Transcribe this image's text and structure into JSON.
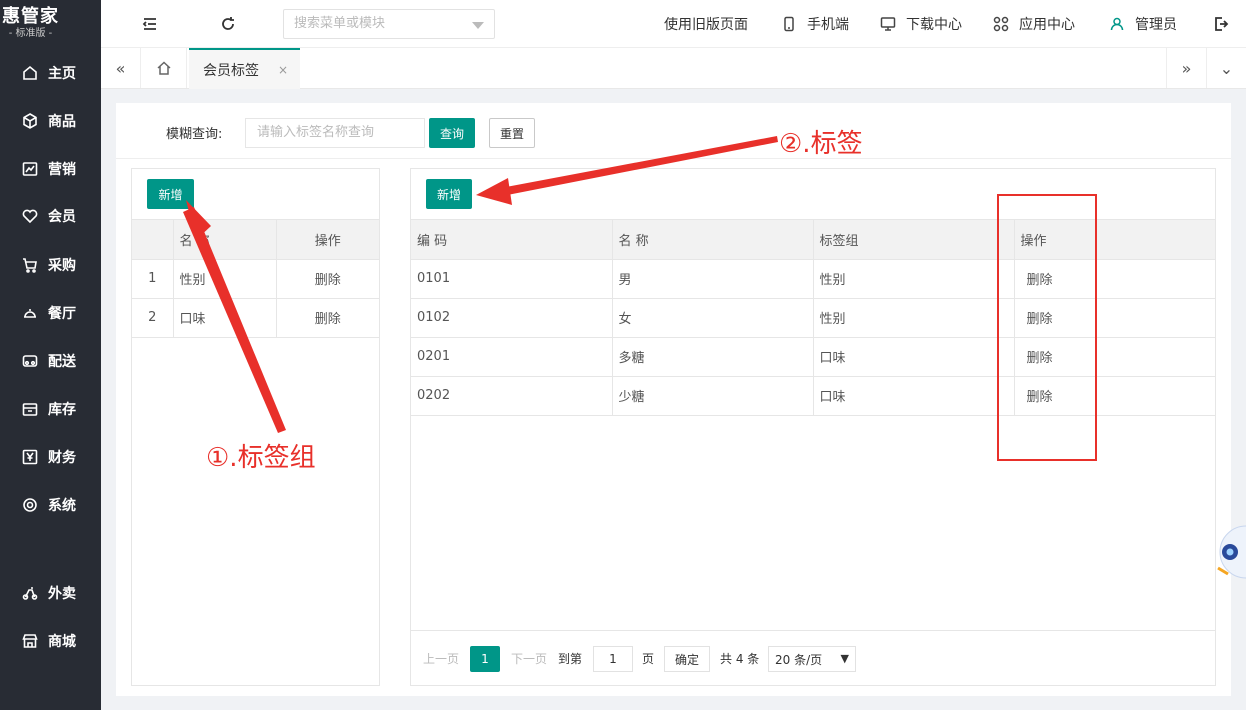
{
  "app": {
    "logo_title": "惠管家",
    "logo_sub": "- 标准版 -"
  },
  "sidebar": {
    "items": [
      {
        "label": "主页",
        "icon": "home-icon"
      },
      {
        "label": "商品",
        "icon": "box-icon"
      },
      {
        "label": "营销",
        "icon": "chart-icon"
      },
      {
        "label": "会员",
        "icon": "heart-icon"
      },
      {
        "label": "采购",
        "icon": "cart-icon"
      },
      {
        "label": "餐厅",
        "icon": "bell-icon"
      },
      {
        "label": "配送",
        "icon": "truck-icon"
      },
      {
        "label": "库存",
        "icon": "warehouse-icon"
      },
      {
        "label": "财务",
        "icon": "yen-icon"
      },
      {
        "label": "系统",
        "icon": "gear-icon"
      },
      {
        "label": "外卖",
        "icon": "scooter-icon"
      },
      {
        "label": "商城",
        "icon": "store-icon"
      }
    ]
  },
  "header": {
    "search_placeholder": "搜索菜单或模块",
    "links": {
      "old_version": "使用旧版页面",
      "mobile": "手机端",
      "download": "下载中心",
      "apps": "应用中心",
      "user": "管理员"
    }
  },
  "tabs": {
    "active": "会员标签",
    "close": "×"
  },
  "query": {
    "label": "模糊查询:",
    "placeholder": "请输入标签名称查询",
    "search_btn": "查询",
    "reset_btn": "重置"
  },
  "left_panel": {
    "add_btn": "新增",
    "headers": [
      "",
      "名 称",
      "操作"
    ],
    "rows": [
      {
        "index": "1",
        "name": "性别",
        "action": "删除"
      },
      {
        "index": "2",
        "name": "口味",
        "action": "删除"
      }
    ]
  },
  "right_panel": {
    "add_btn": "新增",
    "headers": [
      "编 码",
      "名 称",
      "标签组",
      "操作"
    ],
    "rows": [
      {
        "code": "0101",
        "name": "男",
        "group": "性别",
        "action": "删除"
      },
      {
        "code": "0102",
        "name": "女",
        "group": "性别",
        "action": "删除"
      },
      {
        "code": "0201",
        "name": "多糖",
        "group": "口味",
        "action": "删除"
      },
      {
        "code": "0202",
        "name": "少糖",
        "group": "口味",
        "action": "删除"
      }
    ]
  },
  "pager": {
    "prev": "上一页",
    "current": "1",
    "next": "下一页",
    "goto": "到第",
    "page_input": "1",
    "page_unit": "页",
    "confirm": "确定",
    "total": "共 4 条",
    "page_size": "20 条/页"
  },
  "annotations": {
    "label_group": "①.标签组",
    "label": "②.标签"
  },
  "colors": {
    "primary": "#009688",
    "sidebar_bg": "#282c34",
    "delete": "#e54d42",
    "annotation": "#e8302a"
  }
}
